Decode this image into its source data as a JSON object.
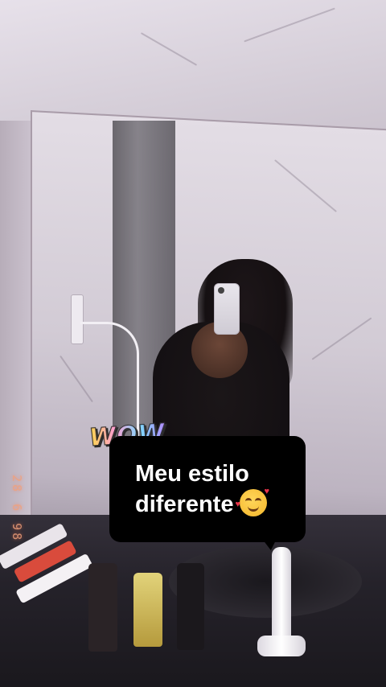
{
  "overlay": {
    "sticker_text": "WOW",
    "caption_line1": "Meu estilo",
    "caption_line2": "diferente",
    "caption_emoji": "smiling-face-with-hearts-icon"
  },
  "datestamp": "28 6 98"
}
